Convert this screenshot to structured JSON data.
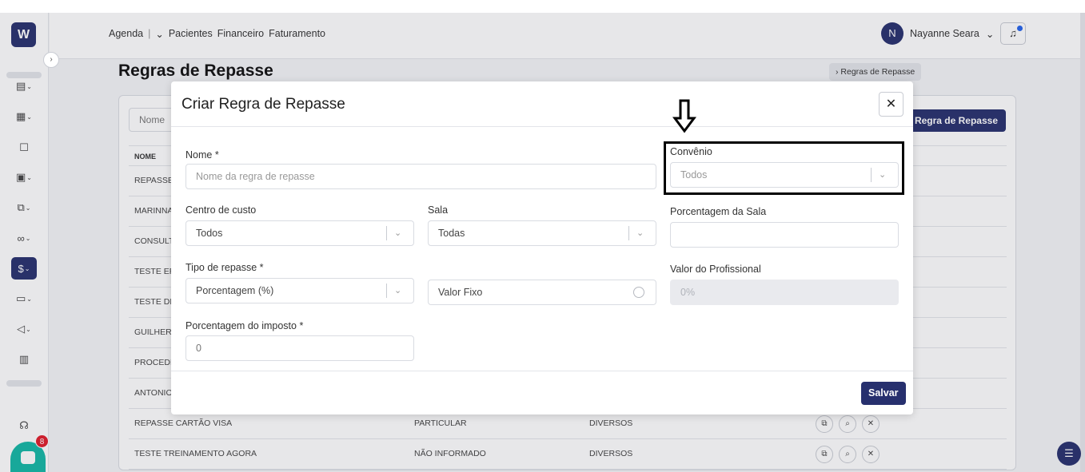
{
  "app": {
    "logo": "W",
    "rail_toggle": "›",
    "rail_items": [
      {
        "icon": "document-icon",
        "glyph": "▤"
      },
      {
        "icon": "calendar-icon",
        "glyph": "▦"
      },
      {
        "icon": "patient-icon",
        "glyph": "☐"
      },
      {
        "icon": "clinic-icon",
        "glyph": "▣"
      },
      {
        "icon": "files-icon",
        "glyph": "⧉"
      },
      {
        "icon": "handshake-icon",
        "glyph": "∞"
      },
      {
        "icon": "finance-icon",
        "glyph": "$"
      },
      {
        "icon": "monitor-icon",
        "glyph": "▭"
      },
      {
        "icon": "megaphone-icon",
        "glyph": "◁"
      },
      {
        "icon": "report-icon",
        "glyph": "▥"
      }
    ],
    "support_icon": "headset-icon",
    "chat_badge": "8"
  },
  "topnav": {
    "agenda": "Agenda",
    "separator": "|",
    "chevron": "⌄",
    "pacientes": "Pacientes",
    "financeiro": "Financeiro",
    "faturamento": "Faturamento"
  },
  "user": {
    "initial": "N",
    "name": "Nayanne Seara",
    "chevron": "⌄"
  },
  "page": {
    "title": "Regras de Repasse",
    "breadcrumb_tail": "Regras de Repasse",
    "breadcrumb_sep": "›",
    "filter_placeholder": "Nome",
    "add_button": "Regra de Repasse",
    "table_header_name": "NOME",
    "rows": [
      {
        "name": "REPASSE",
        "convenio": "",
        "sala": ""
      },
      {
        "name": "MARINNA",
        "convenio": "",
        "sala": ""
      },
      {
        "name": "CONSULT",
        "convenio": "",
        "sala": ""
      },
      {
        "name": "TESTE ER",
        "convenio": "",
        "sala": ""
      },
      {
        "name": "TESTE DE",
        "convenio": "",
        "sala": ""
      },
      {
        "name": "GUILHERM",
        "convenio": "",
        "sala": ""
      },
      {
        "name": "PROCEDI",
        "convenio": "",
        "sala": ""
      },
      {
        "name": "ANTONIO",
        "convenio": "",
        "sala": ""
      },
      {
        "name": "REPASSE CARTÃO VISA",
        "convenio": "PARTICULAR",
        "sala": "DIVERSOS"
      },
      {
        "name": "TESTE TREINAMENTO AGORA",
        "convenio": "NÃO INFORMADO",
        "sala": "DIVERSOS"
      }
    ]
  },
  "modal": {
    "title": "Criar Regra de Repasse",
    "close": "✕",
    "nome": {
      "label": "Nome *",
      "placeholder": "Nome da regra de repasse"
    },
    "convenio": {
      "label": "Convênio",
      "value": "Todos"
    },
    "centro_custo": {
      "label": "Centro de custo",
      "value": "Todos"
    },
    "sala": {
      "label": "Sala",
      "value": "Todas"
    },
    "porcentagem_sala": {
      "label": "Porcentagem da Sala",
      "value": ""
    },
    "tipo_repasse": {
      "label": "Tipo de repasse *",
      "value": "Porcentagem (%)"
    },
    "valor_fixo": {
      "label": "Valor Fixo"
    },
    "valor_profissional": {
      "label": "Valor do Profissional",
      "placeholder": "0%"
    },
    "porcentagem_imposto": {
      "label": "Porcentagem do imposto *",
      "value": "0"
    },
    "save": "Salvar",
    "select_chevron": "⌄"
  },
  "annotation": {
    "arrow": "⇩"
  }
}
